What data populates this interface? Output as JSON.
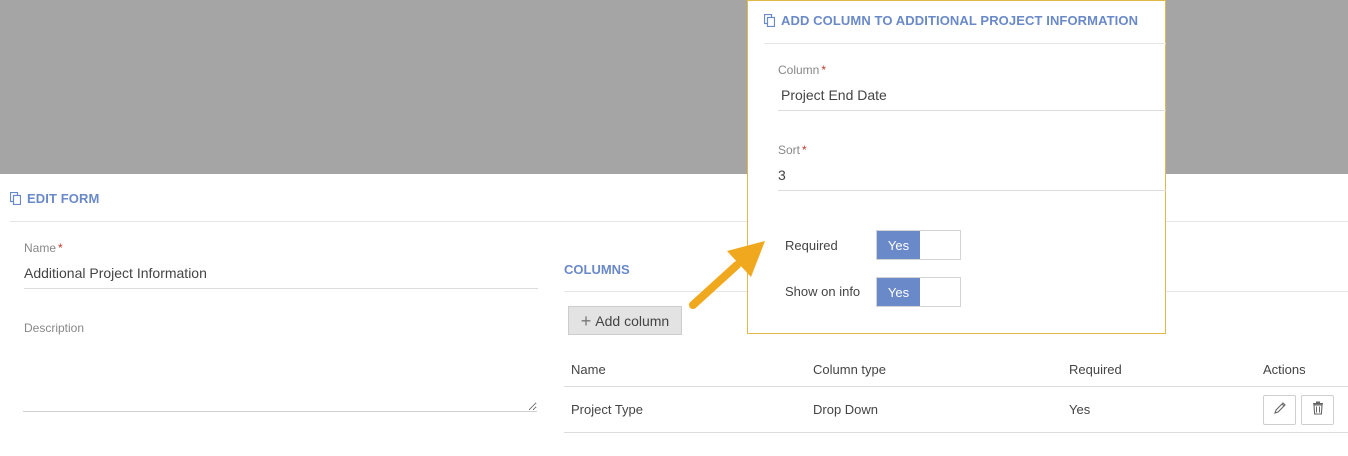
{
  "edit_form": {
    "title": "EDIT FORM",
    "name_label": "Name",
    "name_value": "Additional Project Information",
    "description_label": "Description",
    "description_value": ""
  },
  "columns": {
    "title": "COLUMNS",
    "add_label": "Add column",
    "headers": [
      "Name",
      "Column type",
      "Required",
      "Actions"
    ],
    "rows": [
      {
        "name": "Project Type",
        "type": "Drop Down",
        "required": "Yes"
      }
    ]
  },
  "dialog": {
    "title": "ADD COLUMN TO ADDITIONAL PROJECT INFORMATION",
    "column_label": "Column",
    "column_value": "Project End Date",
    "sort_label": "Sort",
    "sort_value": "3",
    "required_label": "Required",
    "required_value": "Yes",
    "show_label": "Show on info",
    "show_value": "Yes"
  },
  "required_marker": "*",
  "icons": [
    "copy-icon",
    "plus-icon",
    "pencil-icon",
    "trash-icon",
    "arrow-icon"
  ],
  "colors": {
    "accent": "#6a89c9",
    "backdrop": "#a5a5a5",
    "dialog_border": "#e0b94a",
    "arrow": "#f0a91e",
    "required_marker": "#c0392b"
  }
}
